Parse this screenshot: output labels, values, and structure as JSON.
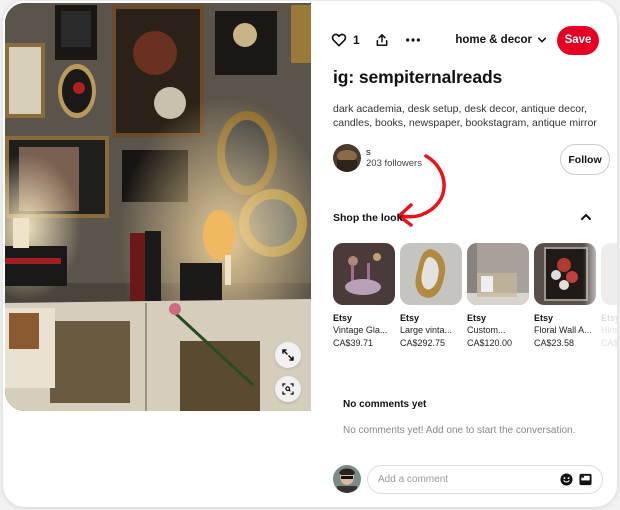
{
  "pin": {
    "image_alt": "Dark academia desk setup with candles, books, newspaper, antique mirrors and framed art",
    "expand_button_icon": "expand-icon",
    "visual_search_button_icon": "lens-icon"
  },
  "action_bar": {
    "like_icon": "heart-icon",
    "like_count": "1",
    "share_icon": "share-icon",
    "more_icon": "more-icon",
    "board_name": "home & decor",
    "board_chevron_icon": "chevron-down-icon",
    "save_label": "Save",
    "save_color": "#e60023"
  },
  "title": "ig: sempiternalreads",
  "description": "dark academia, desk setup, desk decor, antique decor, candles, books, newspaper, bookstagram, antique mirror",
  "creator": {
    "name": "s",
    "followers": "203 followers",
    "follow_label": "Follow"
  },
  "shop": {
    "header": "Shop the look",
    "collapse_icon": "chevron-up-icon",
    "products": [
      {
        "source": "Etsy",
        "name": "Vintage Gla...",
        "price": "CA$39.71"
      },
      {
        "source": "Etsy",
        "name": "Large vinta...",
        "price": "CA$292.75"
      },
      {
        "source": "Etsy",
        "name": "Custom...",
        "price": "CA$120.00"
      },
      {
        "source": "Etsy",
        "name": "Floral Wall A...",
        "price": "CA$23.58"
      },
      {
        "source": "Etsy",
        "name": "Him...",
        "price": "CA$"
      }
    ]
  },
  "annotation": {
    "arrow_color": "#e8141c"
  },
  "comments": {
    "title": "No comments yet",
    "empty_text": "No comments yet! Add one to start the conversation.",
    "input_placeholder": "Add a comment",
    "emoji_icon": "emoji-icon",
    "image_icon": "image-icon"
  }
}
